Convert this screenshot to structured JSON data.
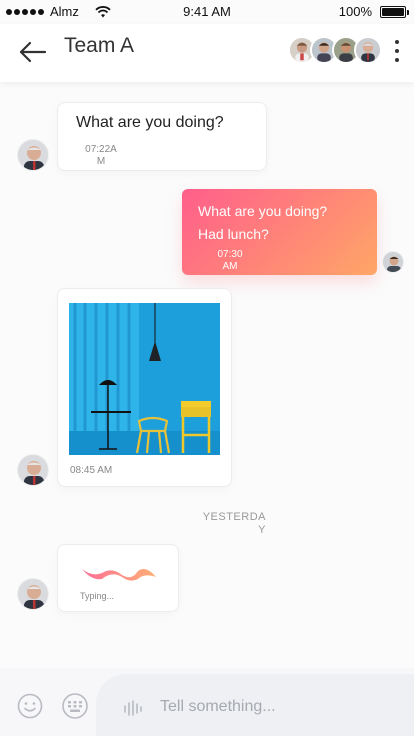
{
  "status_bar": {
    "carrier": "Almz",
    "time": "9:41 AM",
    "battery": "100%",
    "battery_level": 1.0
  },
  "header": {
    "title": "Team A",
    "back_icon": "arrow-left-icon",
    "more_icon": "more-vertical-icon",
    "member_count_shown": 4
  },
  "messages": [
    {
      "sender": "other",
      "text": "What are you doing?",
      "time_line1": "07:22A",
      "time_line2": "M"
    },
    {
      "sender": "me",
      "text": "What are you doing? Had lunch?",
      "time_line1": "07:30",
      "time_line2": "AM"
    },
    {
      "sender": "other",
      "type": "image",
      "time": "08:45 AM"
    },
    {
      "sender": "other",
      "type": "typing",
      "typing_label": "Typing..."
    }
  ],
  "day_separator": {
    "line1": "YESTERDA",
    "line2": "Y"
  },
  "input": {
    "placeholder": "Tell something...",
    "emoji_icon": "smiley-icon",
    "keyboard_icon": "keyboard-icon",
    "voice_icon": "voice-wave-icon"
  },
  "colors": {
    "outgoing_gradient_start": "#ff5e8b",
    "outgoing_gradient_end": "#ffa667",
    "background": "#fbfbfc",
    "input_bg": "#eef0f3"
  }
}
